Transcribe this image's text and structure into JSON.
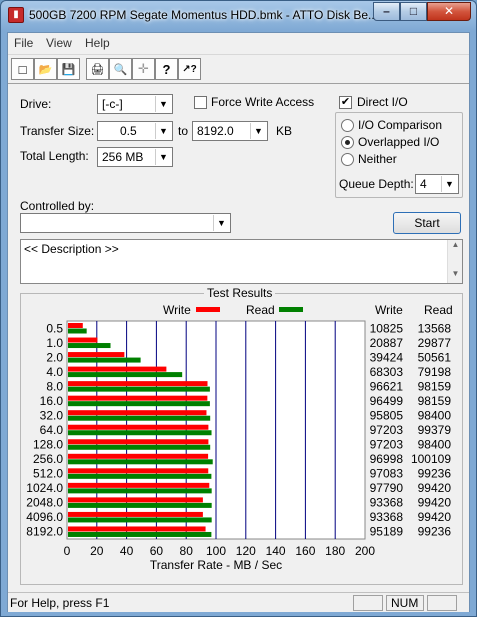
{
  "window": {
    "title": "500GB 7200 RPM Segate Momentus HDD.bmk - ATTO Disk Be...",
    "minimize_glyph": "–",
    "maximize_glyph": "□",
    "close_glyph": "✕"
  },
  "menu": [
    "File",
    "View",
    "Help"
  ],
  "toolbar": {
    "icons": [
      "new-icon",
      "open-icon",
      "save-icon",
      "print-icon",
      "print-preview-icon",
      "move-icon",
      "help-icon",
      "context-help-icon"
    ],
    "glyphs": [
      "□",
      "📂",
      "💾",
      "🖨",
      "🔍",
      "✛",
      "?",
      "↗?"
    ]
  },
  "form": {
    "drive_label": "Drive:",
    "drive_value": "[-c-]",
    "force_write_label": "Force Write Access",
    "force_write_checked": false,
    "direct_io_label": "Direct I/O",
    "direct_io_checked": true,
    "transfer_size_label": "Transfer Size:",
    "transfer_from": "0.5",
    "to_label": "to",
    "transfer_to": "8192.0",
    "kb_label": "KB",
    "total_length_label": "Total Length:",
    "total_length_value": "256 MB",
    "io_comparison_label": "I/O Comparison",
    "overlapped_io_label": "Overlapped I/O",
    "neither_label": "Neither",
    "selected_mode": "Overlapped I/O",
    "queue_depth_label": "Queue Depth:",
    "queue_depth_value": "4",
    "controlled_by_label": "Controlled by:",
    "controlled_by_value": "",
    "start_label": "Start",
    "description_text": "<< Description >>"
  },
  "results": {
    "title": "Test Results",
    "write_legend": "Write",
    "read_legend": "Read",
    "write_col_header": "Write",
    "read_col_header": "Read",
    "write_color": "#ff0000",
    "read_color": "#008000"
  },
  "chart_data": {
    "type": "bar",
    "orientation": "horizontal",
    "xlabel": "Transfer Rate - MB / Sec",
    "xlim": [
      0,
      200
    ],
    "xticks": [
      "0",
      "20",
      "40",
      "60",
      "80",
      "100",
      "120",
      "140",
      "160",
      "180",
      "200"
    ],
    "categories": [
      "0.5",
      "1.0",
      "2.0",
      "4.0",
      "8.0",
      "16.0",
      "32.0",
      "64.0",
      "128.0",
      "256.0",
      "512.0",
      "1024.0",
      "2048.0",
      "4096.0",
      "8192.0"
    ],
    "series": [
      {
        "name": "Write",
        "values": [
          10.6,
          20.4,
          38.5,
          66.7,
          94.3,
          94.2,
          93.6,
          94.9,
          94.9,
          94.7,
          94.8,
          95.5,
          91.2,
          91.2,
          93.0
        ]
      },
      {
        "name": "Read",
        "values": [
          13.2,
          29.2,
          49.4,
          77.3,
          95.9,
          95.9,
          96.1,
          97.0,
          96.1,
          97.8,
          96.9,
          97.1,
          97.1,
          97.1,
          96.9
        ]
      }
    ],
    "write_kbps": [
      "10825",
      "20887",
      "39424",
      "68303",
      "96621",
      "96499",
      "95805",
      "97203",
      "97203",
      "96998",
      "97083",
      "97790",
      "93368",
      "93368",
      "95189"
    ],
    "read_kbps": [
      "13568",
      "29877",
      "50561",
      "79198",
      "98159",
      "98159",
      "98400",
      "99379",
      "98400",
      "100109",
      "99236",
      "99420",
      "99420",
      "99420",
      "99236"
    ],
    "grid": true
  },
  "status": {
    "help_text": "For Help, press F1",
    "num_label": "NUM"
  }
}
